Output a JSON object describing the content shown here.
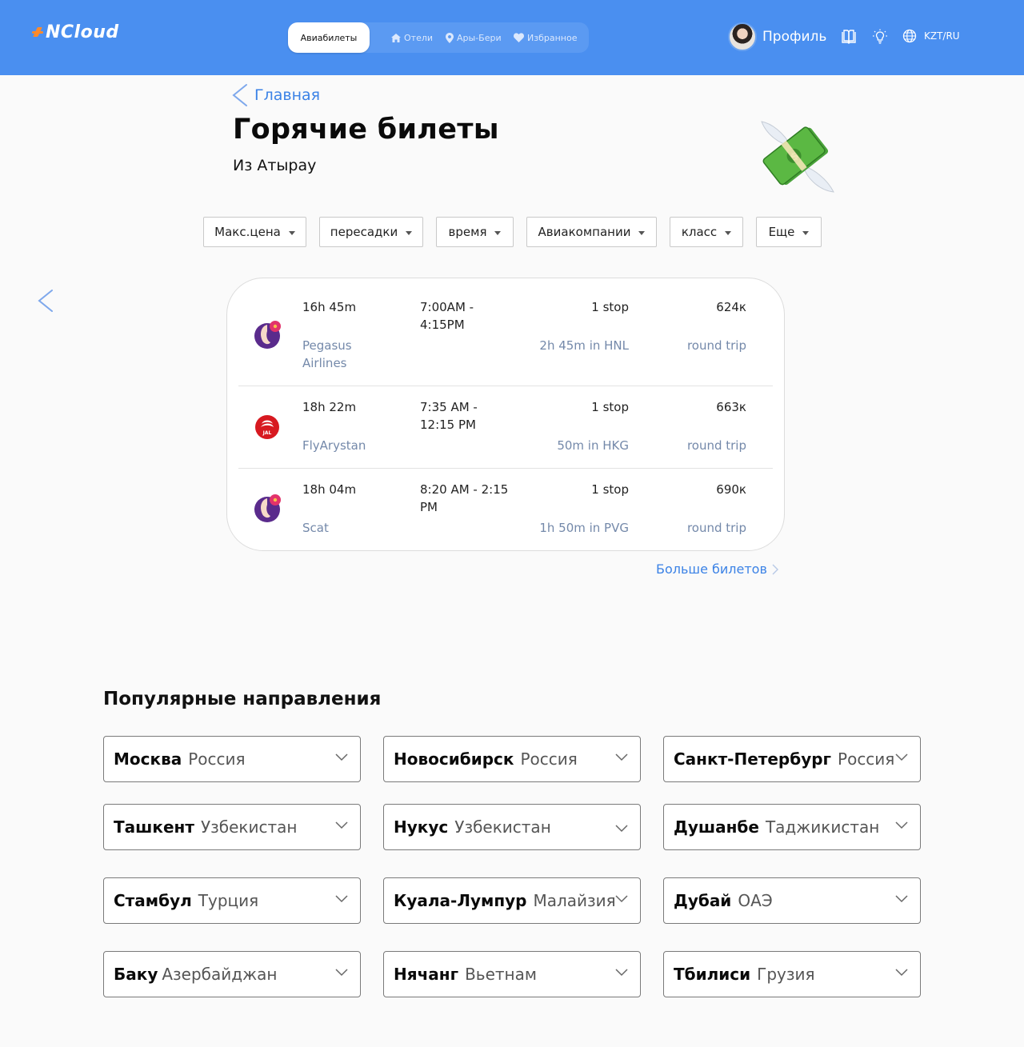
{
  "header": {
    "logo": "NCloud",
    "tabs": [
      {
        "label": "Авиабилеты",
        "active": true,
        "icon": "plane-icon"
      },
      {
        "label": "Отели",
        "active": false,
        "icon": "home-icon"
      },
      {
        "label": "Ары-Бери",
        "active": false,
        "icon": "location-pin-icon"
      },
      {
        "label": "Избранное",
        "active": false,
        "icon": "heart-icon"
      }
    ],
    "profile_label": "Профиль",
    "lang": "KZT/RU",
    "icons": [
      "book-icon",
      "lightbulb-icon",
      "globe-icon"
    ],
    "accent": "#4a8ff0"
  },
  "breadcrumb": {
    "back_label": "Главная"
  },
  "page": {
    "title": "Горячие билеты",
    "subtitle": "Из Атырау"
  },
  "filters": [
    "Макс.цена",
    "пересадки",
    "время",
    "Авиакомпании",
    "класс",
    "Еще"
  ],
  "tickets": [
    {
      "duration": "16h 45m",
      "airline": "Pegasus Airlines",
      "time": "7:00AM - 4:15PM",
      "stops": "1 stop",
      "layover": "2h 45m in HNL",
      "price": "624к",
      "trip": "round trip",
      "logo": "hawaiian-airlines-logo"
    },
    {
      "duration": "18h 22m",
      "airline": "FlyArystan",
      "time": "7:35 AM - 12:15 PM",
      "stops": "1 stop",
      "layover": "50m in HKG",
      "price": "663к",
      "trip": "round trip",
      "logo": "jal-logo"
    },
    {
      "duration": "18h 04m",
      "airline": "Scat",
      "time": "8:20 AM - 2:15 PM",
      "stops": "1 stop",
      "layover": "1h 50m in PVG",
      "price": "690к",
      "trip": "round trip",
      "logo": "hawaiian-airlines-logo"
    }
  ],
  "more_tickets": "Больше билетов",
  "popular": {
    "title": "Популярные направления",
    "items": [
      {
        "city": "Москва",
        "country": "Россия"
      },
      {
        "city": "Новосибирск",
        "country": "Россия"
      },
      {
        "city": "Санкт-Петербург",
        "country": "Россия"
      },
      {
        "city": "Ташкент",
        "country": "Узбекистан"
      },
      {
        "city": "Нукус",
        "country": "Узбекистан"
      },
      {
        "city": "Душанбе",
        "country": "Таджикистан"
      },
      {
        "city": "Стамбул",
        "country": "Турция"
      },
      {
        "city": "Куала-Лумпур",
        "country": "Малайзия"
      },
      {
        "city": "Дубай",
        "country": "ОАЭ"
      },
      {
        "city": "Баку",
        "country": "Азербайджан"
      },
      {
        "city": "Нячанг",
        "country": "Вьетнам"
      },
      {
        "city": "Тбилиси",
        "country": "Грузия"
      }
    ]
  }
}
